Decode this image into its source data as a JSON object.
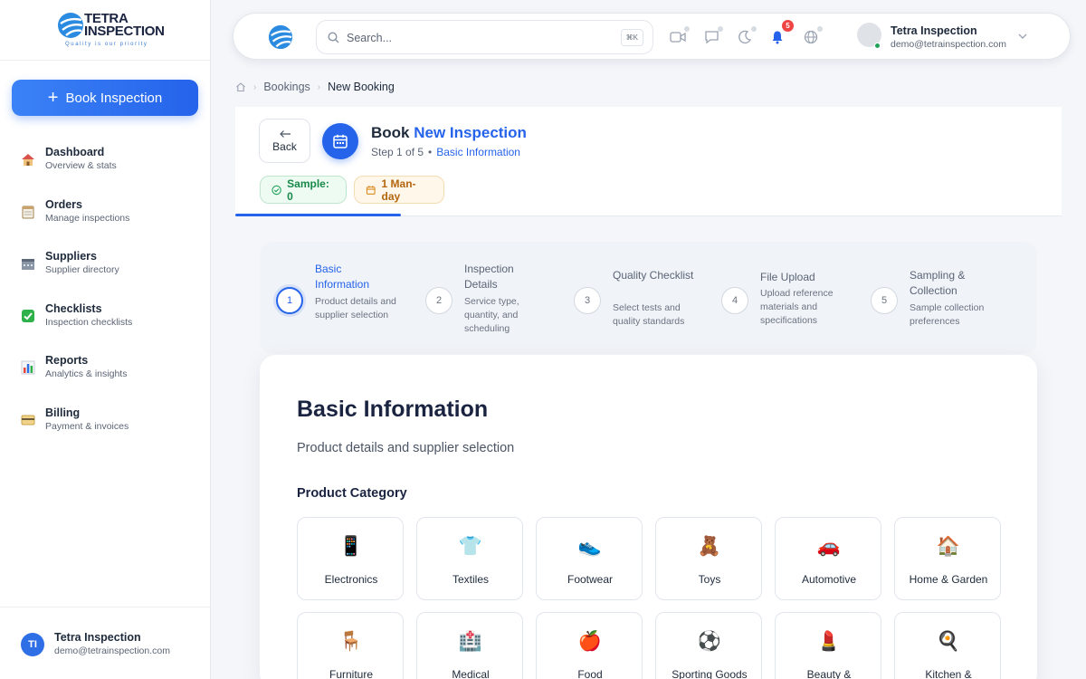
{
  "brand": {
    "name_line1": "TETRA",
    "name_line2": "INSPECTION",
    "tagline": "Quality is our priority",
    "accent": "#2563eb"
  },
  "sidebar": {
    "cta_label": "Book Inspection",
    "items": [
      {
        "title": "Dashboard",
        "subtitle": "Overview & stats",
        "icon": "house-icon"
      },
      {
        "title": "Orders",
        "subtitle": "Manage inspections",
        "icon": "notepad-icon"
      },
      {
        "title": "Suppliers",
        "subtitle": "Supplier directory",
        "icon": "factory-icon"
      },
      {
        "title": "Checklists",
        "subtitle": "Inspection checklists",
        "icon": "check-icon"
      },
      {
        "title": "Reports",
        "subtitle": "Analytics & insights",
        "icon": "chart-icon"
      },
      {
        "title": "Billing",
        "subtitle": "Payment & invoices",
        "icon": "card-icon"
      }
    ],
    "user": {
      "initials": "TI",
      "name": "Tetra Inspection",
      "email": "demo@tetrainspection.com"
    }
  },
  "topbar": {
    "search_placeholder": "Search...",
    "shortcut": "⌘K",
    "notifications_count": "5",
    "user": {
      "name": "Tetra Inspection",
      "email": "demo@tetrainspection.com"
    }
  },
  "breadcrumb": {
    "items": [
      "Bookings",
      "New Booking"
    ]
  },
  "header": {
    "back_label": "Back",
    "title_prefix": "Book",
    "title_accent": "New Inspection",
    "step_text": "Step 1 of 5",
    "step_bullet": "•",
    "step_name": "Basic Information",
    "chip_sample": "Sample: 0",
    "chip_manday": "1 Man-day"
  },
  "stepper": {
    "current": 1,
    "steps": [
      {
        "num": "1",
        "title": "Basic Information",
        "desc": "Product details and supplier selection"
      },
      {
        "num": "2",
        "title": "Inspection Details",
        "desc": "Service type, quantity, and scheduling"
      },
      {
        "num": "3",
        "title": "Quality Checklist",
        "desc": "Select tests and quality standards"
      },
      {
        "num": "4",
        "title": "File Upload",
        "desc": "Upload reference materials and specifications"
      },
      {
        "num": "5",
        "title": "Sampling & Collection",
        "desc": "Sample collection preferences"
      }
    ]
  },
  "main": {
    "title": "Basic Information",
    "subtitle": "Product details and supplier selection",
    "category_label": "Product Category",
    "categories": [
      {
        "label": "Electronics",
        "icon": "📱"
      },
      {
        "label": "Textiles",
        "icon": "👕"
      },
      {
        "label": "Footwear",
        "icon": "👟"
      },
      {
        "label": "Toys",
        "icon": "🧸"
      },
      {
        "label": "Automotive",
        "icon": "🚗"
      },
      {
        "label": "Home & Garden",
        "icon": "🏠"
      },
      {
        "label": "Furniture",
        "icon": "🪑"
      },
      {
        "label": "Medical",
        "icon": "🏥"
      },
      {
        "label": "Food",
        "icon": "🍎"
      },
      {
        "label": "Sporting Goods",
        "icon": "⚽"
      },
      {
        "label": "Beauty &",
        "icon": "💄"
      },
      {
        "label": "Kitchen &",
        "icon": "🍳"
      }
    ]
  }
}
